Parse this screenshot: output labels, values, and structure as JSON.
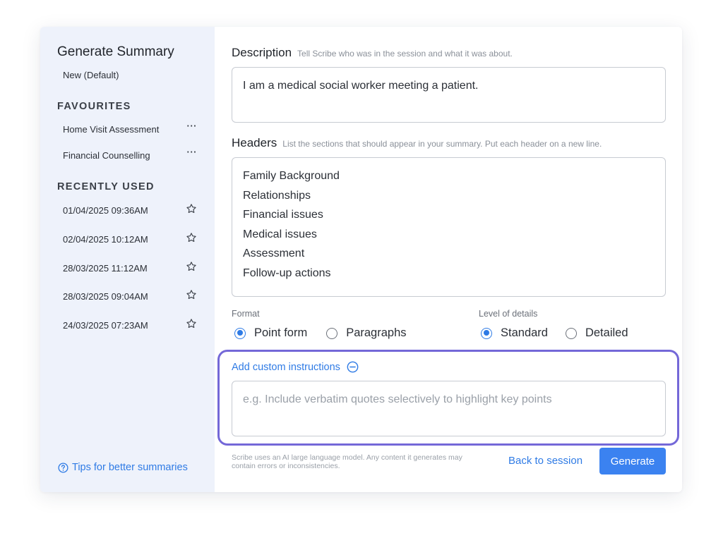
{
  "sidebar": {
    "title": "Generate Summary",
    "default_item": "New (Default)",
    "favourites_heading": "FAVOURITES",
    "favourites": [
      {
        "label": "Home Visit Assessment",
        "more": "···"
      },
      {
        "label": "Financial Counselling",
        "more": "···"
      }
    ],
    "recent_heading": "RECENTLY USED",
    "recent": [
      {
        "label": "01/04/2025 09:36AM",
        "icon": "star-outline-icon"
      },
      {
        "label": "02/04/2025 10:12AM",
        "icon": "star-outline-icon"
      },
      {
        "label": "28/03/2025 11:12AM",
        "icon": "star-outline-icon"
      },
      {
        "label": "28/03/2025 09:04AM",
        "icon": "star-outline-icon"
      },
      {
        "label": "24/03/2025 07:23AM",
        "icon": "star-outline-icon"
      }
    ],
    "tips_label": "Tips for better summaries",
    "tips_icon": "question-circle-icon"
  },
  "description": {
    "label": "Description",
    "hint": "Tell Scribe who was in the session and what it was about.",
    "value": "I am a medical social worker meeting a patient."
  },
  "headers": {
    "label": "Headers",
    "hint": "List the sections that should appear in your summary. Put each header on a new line.",
    "lines": [
      "Family Background",
      "Relationships",
      "Financial issues",
      "Medical issues",
      "Assessment",
      "Follow-up actions"
    ]
  },
  "format": {
    "label": "Format",
    "options": [
      {
        "label": "Point form",
        "selected": true
      },
      {
        "label": "Paragraphs",
        "selected": false
      }
    ]
  },
  "level": {
    "label": "Level of details",
    "options": [
      {
        "label": "Standard",
        "selected": true
      },
      {
        "label": "Detailed",
        "selected": false
      }
    ]
  },
  "custom": {
    "link_label": "Add custom instructions",
    "icon": "minus-circle-icon",
    "placeholder": "e.g. Include verbatim quotes selectively to highlight key points"
  },
  "footer": {
    "disclaimer": "Scribe uses an AI large language model. Any content it generates may contain errors or inconsistencies.",
    "back_label": "Back to session",
    "generate_label": "Generate"
  },
  "colors": {
    "accent": "#2f7be5",
    "button": "#3b82f0",
    "sidebar_bg": "#eef2fb",
    "highlight_border": "#7468d8"
  }
}
